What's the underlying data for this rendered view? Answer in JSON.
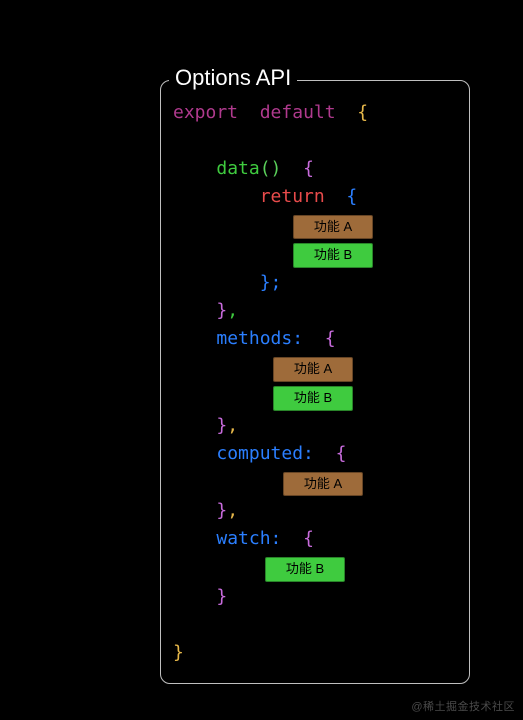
{
  "panel": {
    "title": "Options API"
  },
  "code": {
    "export": "export",
    "default": "default",
    "brace_open": "{",
    "brace_close": "}",
    "data_name": "data",
    "data_parens": "()",
    "return_kw": "return",
    "semicolon_close": "};",
    "comma": ",",
    "methods_label": "methods:",
    "computed_label": "computed:",
    "watch_label": "watch:"
  },
  "tags": {
    "feature_a": "功能 A",
    "feature_b": "功能 B"
  },
  "watermark": "@稀土掘金技术社区"
}
